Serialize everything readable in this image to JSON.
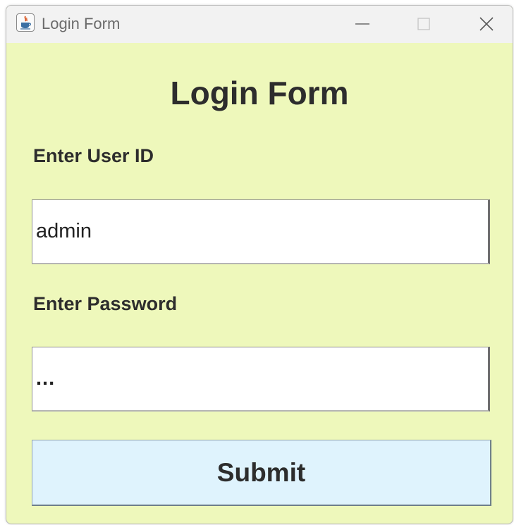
{
  "window": {
    "title": "Login Form",
    "controls": [
      "minimize",
      "maximize",
      "close"
    ],
    "background_color": "#eef8bb",
    "titlebar_color": "#f2f2f2"
  },
  "form": {
    "heading": "Login Form",
    "user_label": "Enter User ID",
    "user_value": "admin",
    "password_label": "Enter Password",
    "password_value": "...",
    "submit_label": "Submit",
    "submit_color": "#dff3fd"
  },
  "icons": {
    "app": "java-icon",
    "minimize": "minimize-icon",
    "maximize": "maximize-icon",
    "close": "close-icon"
  }
}
